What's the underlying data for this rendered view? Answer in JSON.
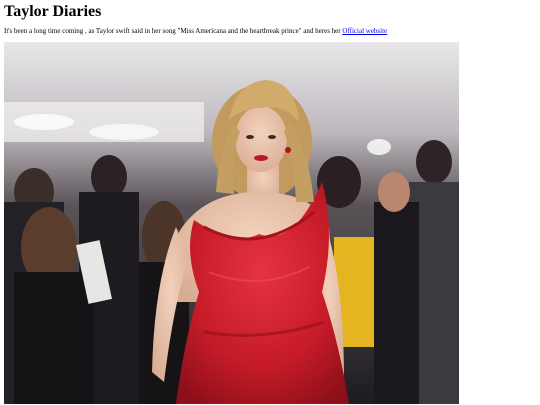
{
  "page": {
    "title": "Taylor Diaries",
    "intro_text": "It's been a long time coming , as Taylor swift said in her song \"Miss Americana and the heartbreak prince\" and heres her",
    "link_label": "Official website"
  },
  "photo": {
    "subject": "woman in red sparkly dress at event",
    "dress_color": "#cc1e2a",
    "hair_color": "#c9a46a"
  }
}
